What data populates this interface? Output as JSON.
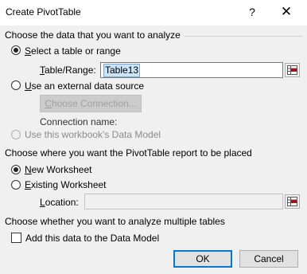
{
  "window": {
    "title": "Create PivotTable",
    "help_glyph": "?",
    "close_glyph": "✕"
  },
  "section_data": {
    "heading": "Choose the data that you want to analyze",
    "select_table_label": "Select a table or range",
    "table_range_label": "Table/Range:",
    "table_range_value": "Table13",
    "external_source_label": "Use an external data source",
    "choose_connection_label": "Choose Connection...",
    "connection_name_label": "Connection name:",
    "data_model_label": "Use this workbook's Data Model"
  },
  "section_placement": {
    "heading": "Choose where you want the PivotTable report to be placed",
    "new_worksheet_label": "New Worksheet",
    "existing_worksheet_label": "Existing Worksheet",
    "location_label": "Location:",
    "location_value": ""
  },
  "section_multiple": {
    "heading": "Choose whether you want to analyze multiple tables",
    "add_to_data_model_label": "Add this data to the Data Model"
  },
  "buttons": {
    "ok_label": "OK",
    "cancel_label": "Cancel"
  },
  "state": {
    "select_table_checked": true,
    "external_source_checked": false,
    "data_model_enabled": false,
    "new_worksheet_checked": true,
    "existing_worksheet_checked": false,
    "add_to_data_model_checked": false
  },
  "icons": {
    "range_picker": "range-picker-icon"
  },
  "colors": {
    "selection_highlight": "#cce4f7",
    "default_button_border": "#0078d7"
  }
}
